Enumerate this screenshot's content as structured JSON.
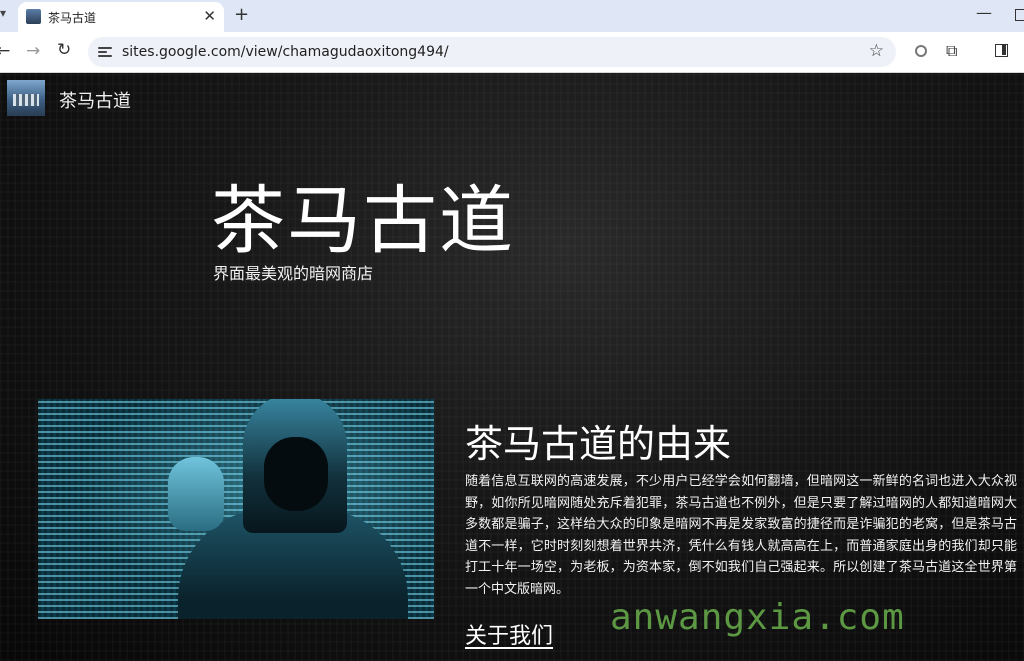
{
  "browser": {
    "tab_title": "茶马古道",
    "tab_close": "✕",
    "new_tab": "+",
    "url": "sites.google.com/view/chamagudaoxitong494/",
    "minimize": "—"
  },
  "site": {
    "name": "茶马古道",
    "hero_title": "茶马古道",
    "hero_subtitle": "界面最美观的暗网商店",
    "section_title": "茶马古道的由来",
    "section_body": "随着信息互联网的高速发展，不少用户已经学会如何翻墙，但暗网这一新鲜的名词也进入大众视野，如你所见暗网随处充斥着犯罪，茶马古道也不例外，但是只要了解过暗网的人都知道暗网大多数都是骗子，这样给大众的印象是暗网不再是发家致富的捷径而是诈骗犯的老窝，但是茶马古道不一样，它时时刻刻想着世界共济，凭什么有钱人就高高在上，而普通家庭出身的我们却只能打工十年一场空，为老板，为资本家，倒不如我们自己强起来。所以创建了茶马古道这全世界第一个中文版暗网。",
    "about_link": "关于我们",
    "watermark": "anwangxia.com"
  },
  "icons": {
    "back": "arrow-left-icon",
    "forward": "arrow-right-icon",
    "reload": "reload-icon",
    "site_info": "tune-icon",
    "bookmark": "star-icon",
    "extension": "puzzle-icon",
    "side_panel": "side-panel-icon"
  },
  "colors": {
    "page_background": "#0e0e0e",
    "tabbar_background": "#dfe7f6",
    "watermark": "#6ab04c"
  }
}
